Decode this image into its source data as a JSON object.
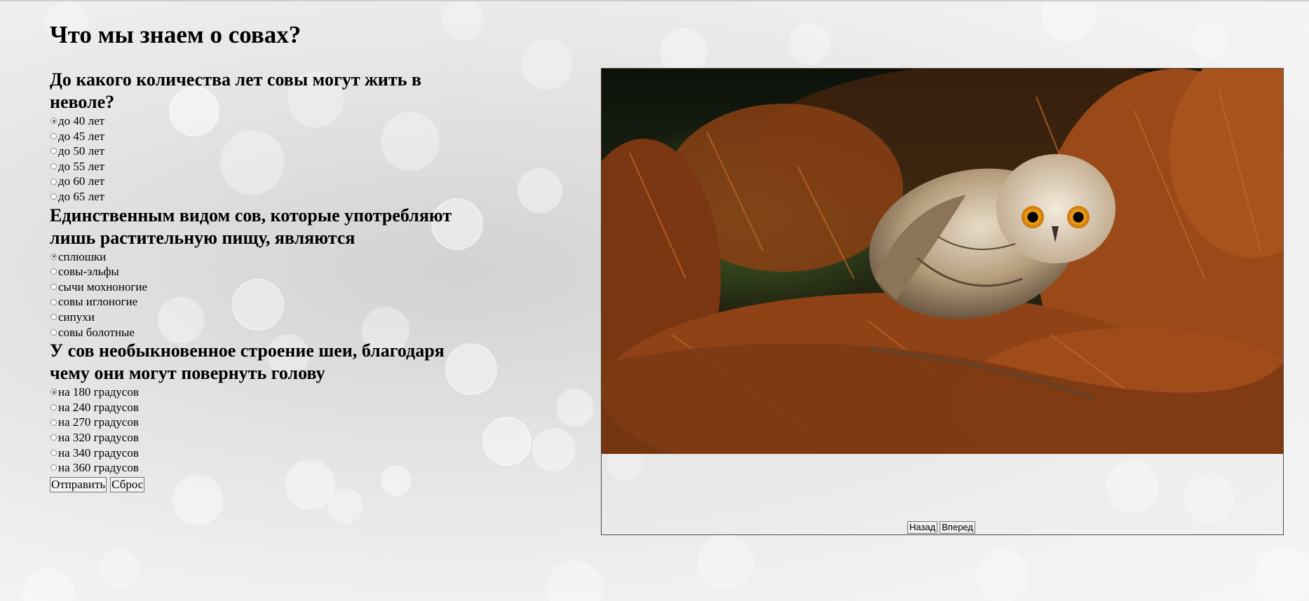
{
  "page": {
    "title": "Что мы знаем о совах?"
  },
  "quiz": {
    "questions": [
      {
        "text": "До какого количества лет совы могут жить в неволе?",
        "options": [
          "до 40 лет",
          "до 45 лет",
          "до 50 лет",
          "до 55 лет",
          "до 60 лет",
          "до 65 лет"
        ],
        "selected_index": 0
      },
      {
        "text": "Единственным видом сов, которые употребляют лишь растительную пищу, являются",
        "options": [
          "сплюшки",
          "совы-эльфы",
          "сычи мохноногие",
          "совы иглоногие",
          "сипухи",
          "совы болотные"
        ],
        "selected_index": 0
      },
      {
        "text": "У сов необыкновенное строение шеи, благодаря чему они могут повернуть голову",
        "options": [
          "на 180 градусов",
          "на 240 градусов",
          "на 270 градусов",
          "на 320 градусов",
          "на 340 градусов",
          "на 360 градусов"
        ],
        "selected_index": 0
      }
    ],
    "submit_label": "Отправить",
    "reset_label": "Сброс"
  },
  "slider": {
    "prev_label": "Назад",
    "next_label": "Вперед"
  }
}
